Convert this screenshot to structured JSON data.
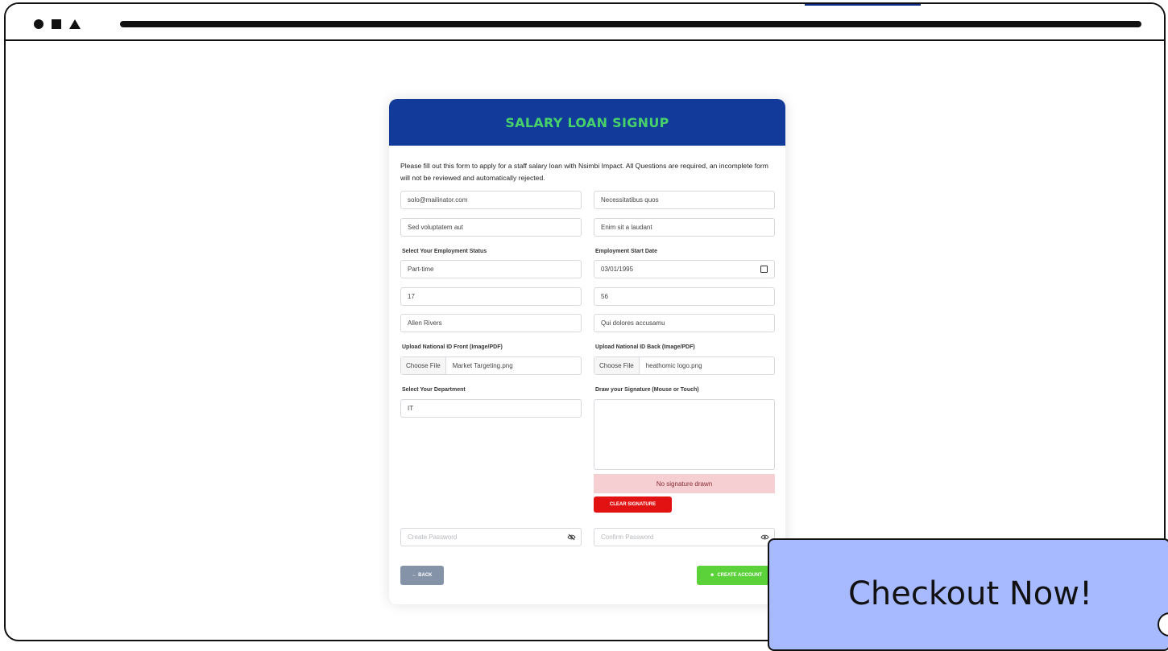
{
  "browser": {
    "controls": [
      "circle",
      "square",
      "triangle"
    ]
  },
  "form": {
    "title": "SALARY LOAN SIGNUP",
    "intro": "Please fill out this form to apply for a staff salary loan with Nsimbi Impact. All Questions are required, an incomplete form will not be reviewed and automatically rejected.",
    "fields": {
      "email": "solo@mailinator.com",
      "field_top_right": "Necessitatibus quos",
      "field_second_left": "Sed voluptatem aut",
      "field_second_right": "Enim sit a laudant",
      "employment_status_label": "Select Your Employment Status",
      "employment_status_value": "Part-time",
      "employment_start_label": "Employment Start Date",
      "employment_start_value": "03/01/1995",
      "field_num_left": "17",
      "field_num_right": "56",
      "field_name_left": "Allen Rivers",
      "field_name_right": "Qui dolores accusamu",
      "id_front_label": "Upload National ID Front (Image/PDF)",
      "id_back_label": "Upload National ID Back (Image/PDF)",
      "choose_file": "Choose File",
      "id_front_file": "Market Targeting.png",
      "id_back_file": "heathomic logo.png",
      "department_label": "Select Your Department",
      "department_value": "IT",
      "signature_label": "Draw your Signature (Mouse or Touch)",
      "signature_status": "No signature drawn",
      "clear_signature": "CLEAR SIGNATURE",
      "password_placeholder": "Create Password",
      "confirm_password_placeholder": "Confirm Password",
      "back_label": "← BACK",
      "create_account_label": "CREATE ACCOUNT"
    }
  },
  "overlay": {
    "checkout_label": "Checkout Now!"
  },
  "colors": {
    "header_blue": "#123a9a",
    "title_green": "#47d16a",
    "clear_red": "#e31212",
    "create_green": "#5bd13a",
    "back_gray": "#8593a9",
    "checkout_bg": "#a7b9ff"
  },
  "icons": [
    "calendar-icon",
    "eye-slash-icon",
    "user-plus-icon",
    "arrow-left-icon"
  ]
}
